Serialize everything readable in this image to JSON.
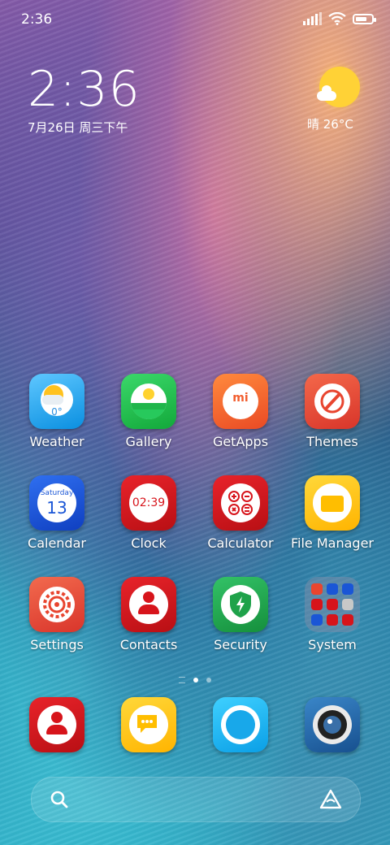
{
  "status_bar": {
    "time": "2:36",
    "battery_level": 0.6
  },
  "clock_widget": {
    "time": "2:36",
    "date": "7月26日 周三下午"
  },
  "weather_widget": {
    "text": "晴 26°C"
  },
  "apps": [
    {
      "label": "Weather",
      "icon": "weather-app-icon",
      "temp": "0°"
    },
    {
      "label": "Gallery",
      "icon": "gallery-app-icon"
    },
    {
      "label": "GetApps",
      "icon": "getapps-app-icon",
      "logo": "mi"
    },
    {
      "label": "Themes",
      "icon": "themes-app-icon"
    },
    {
      "label": "Calendar",
      "icon": "calendar-app-icon",
      "day_name": "Saturday",
      "day": "13"
    },
    {
      "label": "Clock",
      "icon": "clock-app-icon",
      "time": "02:39"
    },
    {
      "label": "Calculator",
      "icon": "calculator-app-icon"
    },
    {
      "label": "File Manager",
      "icon": "file-manager-app-icon"
    },
    {
      "label": "Settings",
      "icon": "settings-app-icon"
    },
    {
      "label": "Contacts",
      "icon": "contacts-app-icon"
    },
    {
      "label": "Security",
      "icon": "security-app-icon"
    },
    {
      "label": "System",
      "icon": "system-folder-icon"
    }
  ],
  "dock": [
    {
      "icon": "phone-app-icon"
    },
    {
      "icon": "messages-app-icon"
    },
    {
      "icon": "browser-app-icon"
    },
    {
      "icon": "camera-app-icon"
    }
  ],
  "page_indicator": {
    "pages": 2,
    "current": 1
  },
  "colors": {
    "weather": "#1aa5f0",
    "gallery": "#22c24a",
    "getapps": "#f25d2e",
    "themes": "#e8452f",
    "calendar": "#1a56d6",
    "red": "#d7141b",
    "security": "#1fa24a",
    "file_manager": "#ffc400"
  }
}
